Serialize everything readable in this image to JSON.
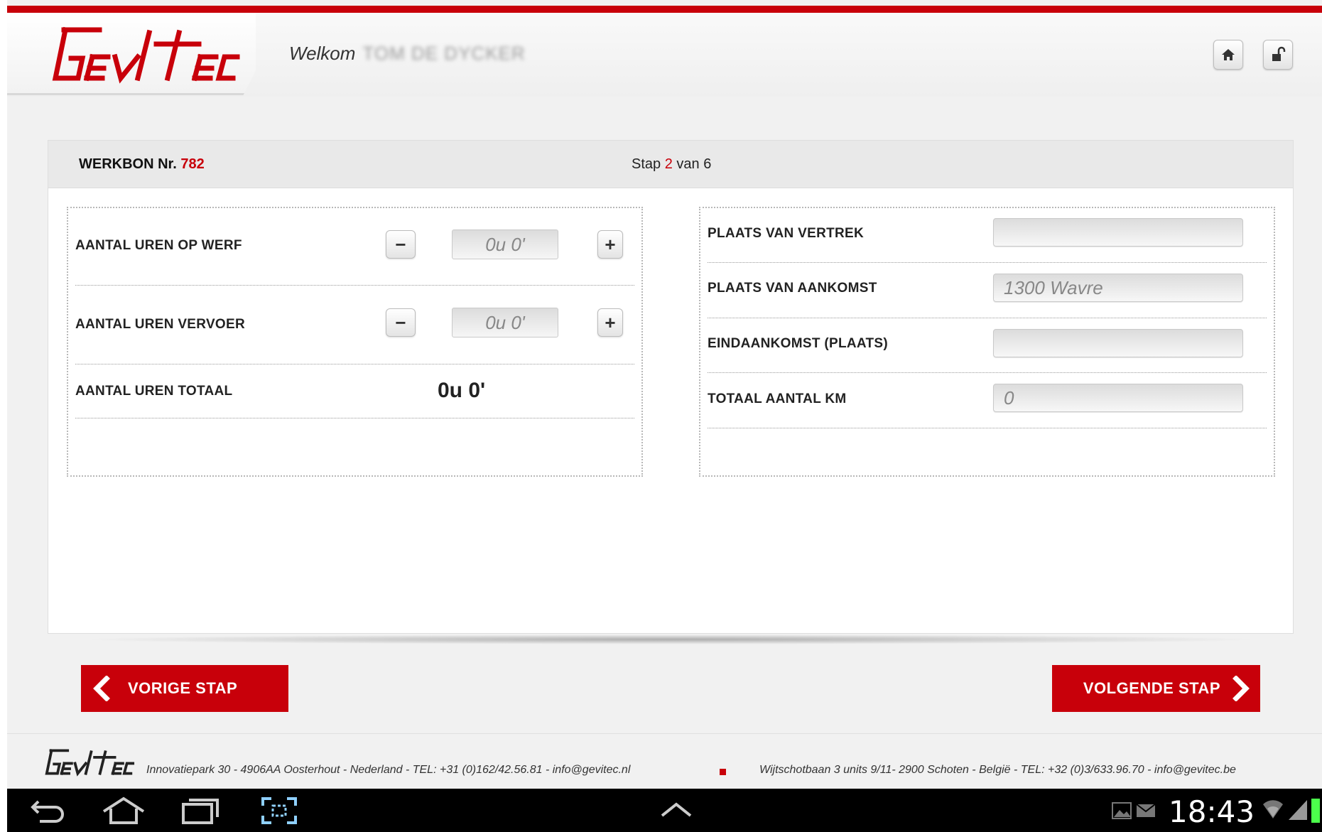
{
  "header": {
    "welcome_label": "Welkom",
    "user_name": "TOM DE DYCKER",
    "home_icon": "home-icon",
    "lock_icon": "unlock-icon"
  },
  "workorder": {
    "werkbon_label": "WERKBON Nr.",
    "werkbon_number": "782",
    "step_prefix": "Stap",
    "step_current": "2",
    "step_mid": "van",
    "step_total": "6"
  },
  "left_panel": {
    "rows": [
      {
        "label": "AANTAL UREN OP WERF",
        "value": "0u 0'"
      },
      {
        "label": "AANTAL UREN VERVOER",
        "value": "0u 0'"
      },
      {
        "label": "AANTAL UREN TOTAAL",
        "value": "0u 0'"
      }
    ],
    "minus_symbol": "−",
    "plus_symbol": "+"
  },
  "right_panel": {
    "rows": [
      {
        "label": "PLAATS VAN VERTREK",
        "value": ""
      },
      {
        "label": "PLAATS VAN AANKOMST",
        "value": "1300 Wavre"
      },
      {
        "label": "EINDAANKOMST (PLAATS)",
        "value": ""
      },
      {
        "label": "TOTAAL AANTAL KM",
        "value": "0"
      }
    ]
  },
  "nav": {
    "prev_label": "VORIGE STAP",
    "next_label": "VOLGENDE STAP"
  },
  "footer": {
    "address_nl": "Innovatiepark 30 - 4906AA Oosterhout - Nederland - TEL: +31 (0)162/42.56.81 - info@gevitec.nl",
    "address_be": "Wijtschotbaan 3 units 9/11- 2900 Schoten - België - TEL: +32 (0)3/633.96.70 - info@gevitec.be"
  },
  "system_bar": {
    "time": "18:43"
  },
  "colors": {
    "brand_red": "#c8000a",
    "background": "#f1f1f1"
  }
}
